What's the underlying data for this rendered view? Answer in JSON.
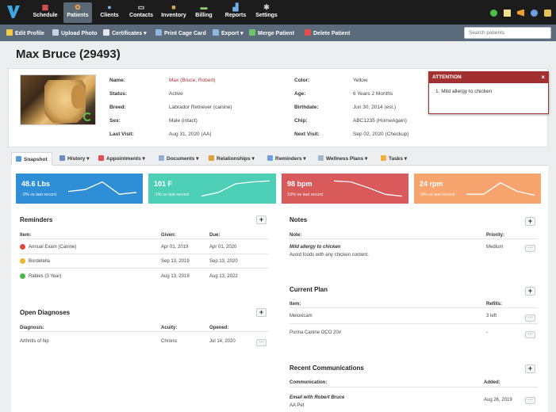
{
  "nav": {
    "items": [
      {
        "label": "Schedule",
        "icon": "calendar-icon"
      },
      {
        "label": "Patients",
        "icon": "paw-icon"
      },
      {
        "label": "Clients",
        "icon": "users-icon"
      },
      {
        "label": "Contacts",
        "icon": "address-card-icon"
      },
      {
        "label": "Inventory",
        "icon": "box-icon"
      },
      {
        "label": "Billing",
        "icon": "credit-card-icon"
      },
      {
        "label": "Reports",
        "icon": "chart-icon"
      },
      {
        "label": "Settings",
        "icon": "gear-icon"
      }
    ],
    "active": "Patients"
  },
  "actions": {
    "edit_profile": "Edit Profile",
    "upload_photo": "Upload Photo",
    "certificates": "Certificates",
    "print_cage_card": "Print Cage Card",
    "export": "Export",
    "merge_patient": "Merge Patient",
    "delete_patient": "Delete Patient",
    "search_placeholder": "Search patients"
  },
  "patient": {
    "title": "Max Bruce (29493)",
    "labels": {
      "name": "Name:",
      "status": "Status:",
      "breed": "Breed:",
      "sex": "Sex:",
      "last_visit": "Last Visit:",
      "color": "Color:",
      "age": "Age:",
      "birthdate": "Birthdate:",
      "chip": "Chip:",
      "next_visit": "Next Visit:"
    },
    "name": "Max (Bruce, Robert)",
    "status": "Active",
    "breed": "Labrador Retriever (canine)",
    "sex": "Male (intact)",
    "last_visit": "Aug 31, 2020 (AA)",
    "color": "Yellow",
    "age": "6 Years 2 Months",
    "birthdate": "Jun 30, 2014 (est.)",
    "chip": "ABC1235 (HomeAgain)",
    "next_visit": "Sep 02, 2020 (Checkup)"
  },
  "attention": {
    "title": "ATTENTION",
    "close": "×",
    "item": "1. Mild allergy to chicken"
  },
  "tabs": [
    "Snapshot",
    "History",
    "Appointments",
    "Documents",
    "Relationships",
    "Reminders",
    "Wellness Plans",
    "Tasks"
  ],
  "stats": [
    {
      "value": "48.6 Lbs",
      "sub": "-2% vs last record",
      "color": "#2f8fd6",
      "trend": [
        0.35,
        0.45,
        0.85,
        0.2,
        0.3
      ]
    },
    {
      "value": "101 F",
      "sub": "-1% vs last record",
      "color": "#4ccfb5",
      "trend": [
        0.1,
        0.3,
        0.75,
        0.85,
        0.9
      ]
    },
    {
      "value": "98 bpm",
      "sub": "10% vs last record",
      "color": "#d85a5a",
      "trend": [
        0.9,
        0.85,
        0.55,
        0.2,
        0.1
      ]
    },
    {
      "value": "24 rpm",
      "sub": "-8% vs last record",
      "color": "#f7a46f",
      "trend": [
        0.2,
        0.2,
        0.8,
        0.35,
        0.15
      ]
    }
  ],
  "reminders": {
    "title": "Reminders",
    "headers": {
      "item": "Item:",
      "given": "Given:",
      "due": "Due:"
    },
    "rows": [
      {
        "item": "Annual Exam (Canine)",
        "given": "Apr 01, 2019",
        "due": "Apr 01, 2020",
        "status_color": "#e0483e",
        "icon": "overdue-icon"
      },
      {
        "item": "Bordetella",
        "given": "Sep 13, 2019",
        "due": "Sep 13, 2020",
        "status_color": "#f0b429",
        "icon": "warning-icon"
      },
      {
        "item": "Rabies (3 Year)",
        "given": "Aug 13, 2019",
        "due": "Aug 13, 2022",
        "status_color": "#4cb84a",
        "icon": "check-icon"
      }
    ]
  },
  "diagnoses": {
    "title": "Open Diagnoses",
    "headers": {
      "diagnosis": "Diagnosis:",
      "acuity": "Acuity:",
      "opened": "Opened:"
    },
    "rows": [
      {
        "diagnosis": "Arthritis of hip",
        "acuity": "Chronic",
        "opened": "Jul 14, 2020"
      }
    ]
  },
  "notes": {
    "title": "Notes",
    "headers": {
      "note": "Note:",
      "priority": "Priority:"
    },
    "rows": [
      {
        "title": "Mild allergy to chicken",
        "body": "Avoid foods with any chicken content.",
        "priority": "Medium"
      }
    ]
  },
  "plan": {
    "title": "Current Plan",
    "headers": {
      "item": "Item:",
      "refills": "Refills:"
    },
    "rows": [
      {
        "item": "Meloxicam",
        "refills": "3 left"
      },
      {
        "item": "Purina Canine OCO 20#",
        "refills": "-"
      }
    ]
  },
  "communications": {
    "title": "Recent Communications",
    "headers": {
      "communication": "Communication:",
      "added": "Added:"
    },
    "rows": [
      {
        "title": "Email with Robert Bruce",
        "sub": "AA Pet",
        "added": "Aug 26, 2019"
      }
    ]
  },
  "ui": {
    "plus": "+",
    "more": "···",
    "caret": "▾"
  }
}
